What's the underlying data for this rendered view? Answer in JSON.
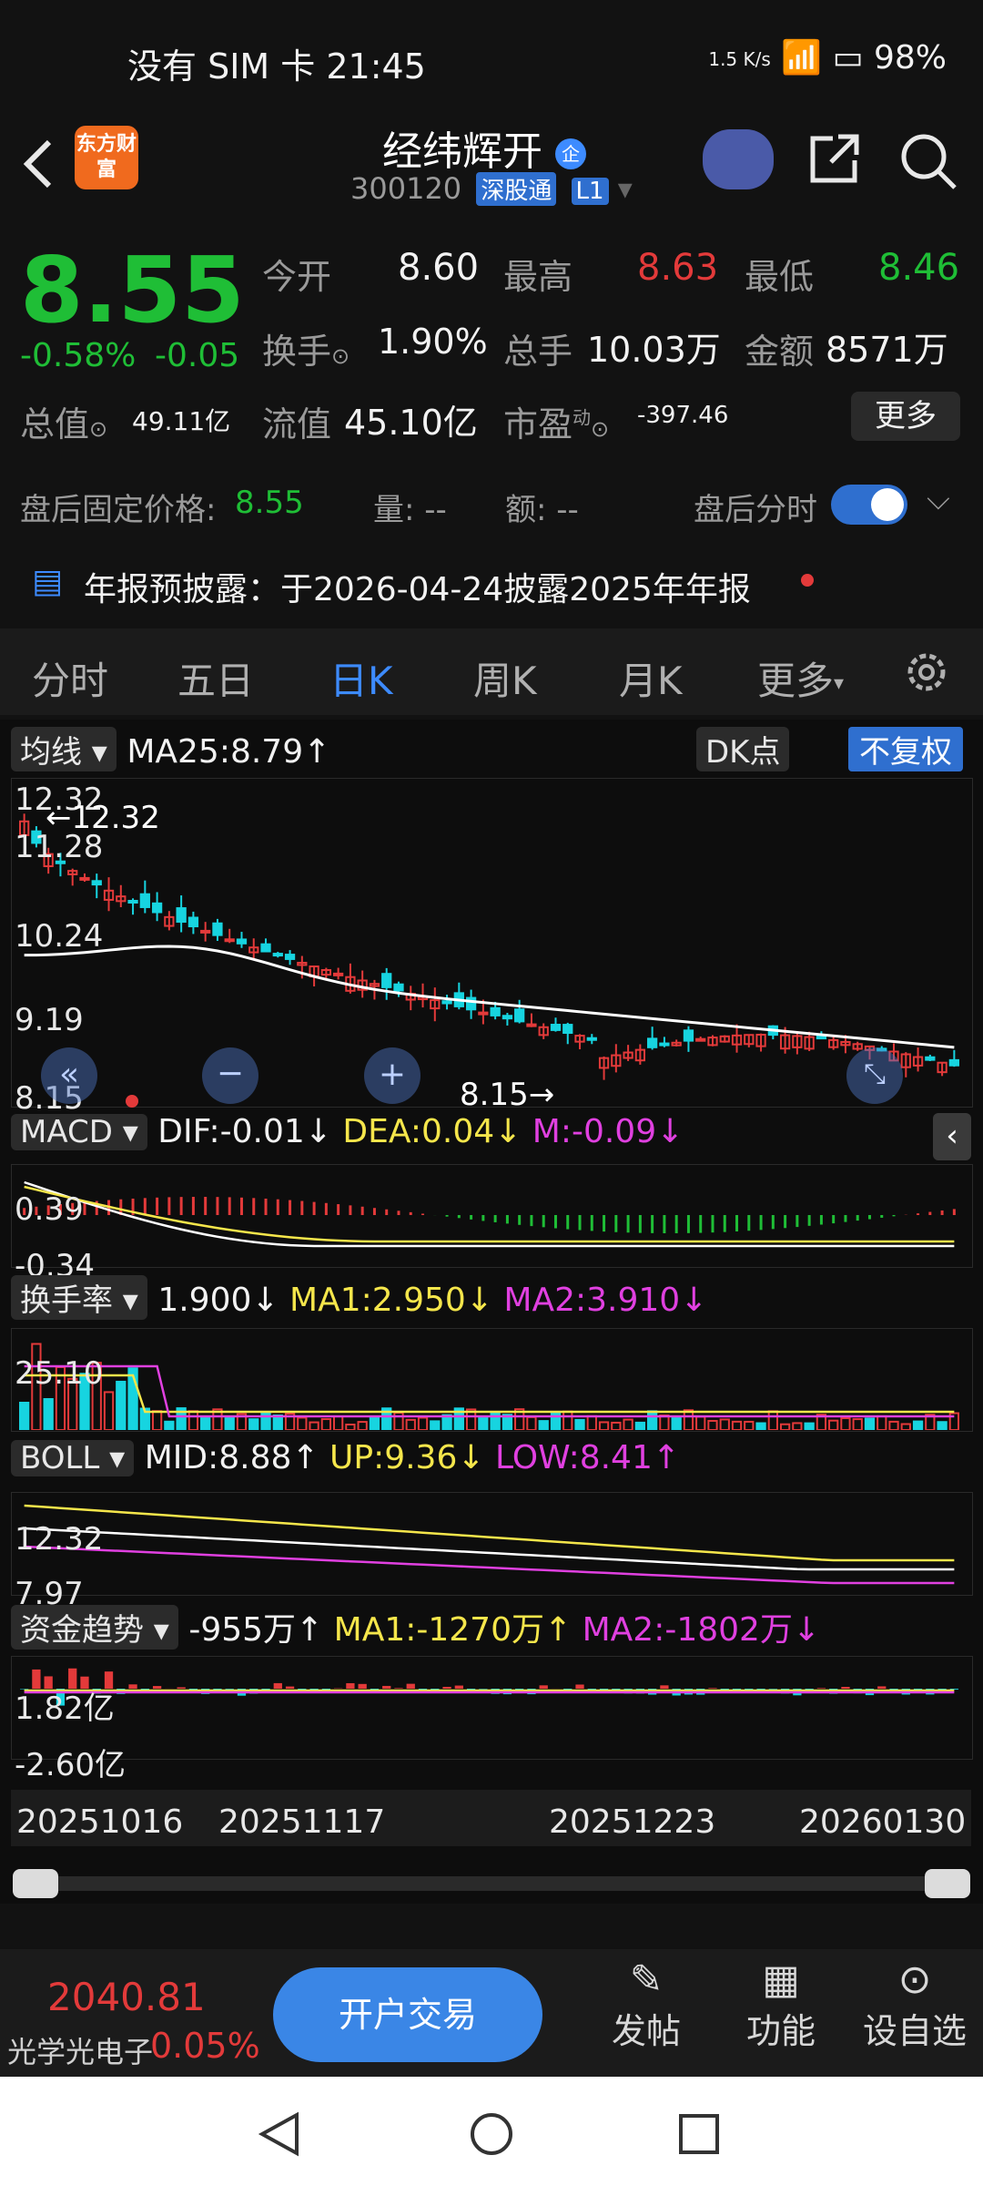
{
  "status_bar": {
    "time": "没有 SIM 卡 21:45",
    "speed": "1.5 K/s",
    "battery": "98%"
  },
  "header": {
    "name": "经纬辉开",
    "code": "300120",
    "badge1": "深股通",
    "badge2": "L1",
    "logo_text": "东方财富"
  },
  "quote": {
    "price": "8.55",
    "change_pct": "-0.58%",
    "change": "-0.05",
    "open_label": "今开",
    "open": "8.60",
    "high_label": "最高",
    "high": "8.63",
    "low_label": "最低",
    "low": "8.46",
    "turnover_label": "换手",
    "turnover": "1.90%",
    "volume_label": "总手",
    "volume": "10.03万",
    "amount_label": "金额",
    "amount": "8571万",
    "mktcap_label": "总值",
    "mktcap": "49.11亿",
    "float_label": "流值",
    "float": "45.10亿",
    "pe_label": "市盈",
    "pe_sup": "动",
    "pe": "-397.46",
    "more": "更多"
  },
  "after_hours": {
    "label": "盘后固定价格:",
    "price": "8.55",
    "vol_label": "量: --",
    "amt_label": "额: --",
    "toggle_label": "盘后分时"
  },
  "notice": {
    "text": "年报预披露：于2026-04-24披露2025年年报"
  },
  "tabs": [
    "分时",
    "五日",
    "日K",
    "周K",
    "月K",
    "更多"
  ],
  "kline": {
    "ma_chip": "均线",
    "ma_text": "MA25:8.79↑",
    "dk_chip": "DK点",
    "fq_chip": "不复权",
    "y_labels": [
      "12.32",
      "11.28",
      "10.24",
      "9.19",
      "8.15"
    ],
    "max_note": "←12.32",
    "min_note": "8.15→"
  },
  "macd": {
    "chip": "MACD",
    "dif": "DIF:-0.01↓",
    "dea": "DEA:0.04↓",
    "m": "M:-0.09↓",
    "y_labels": [
      "0.39",
      "-0.34"
    ]
  },
  "turnover_panel": {
    "chip": "换手率",
    "v": "1.900↓",
    "ma1": "MA1:2.950↓",
    "ma2": "MA2:3.910↓",
    "y_labels": [
      "25.10",
      ""
    ]
  },
  "boll": {
    "chip": "BOLL",
    "mid": "MID:8.88↑",
    "up": "UP:9.36↓",
    "low": "LOW:8.41↑",
    "y_labels": [
      "12.32",
      "7.97"
    ]
  },
  "fund": {
    "chip": "资金趋势",
    "v": "-955万↑",
    "ma1": "MA1:-1270万↑",
    "ma2": "MA2:-1802万↓",
    "y_labels": [
      "1.82亿",
      "-2.60亿"
    ]
  },
  "dates": [
    "20251016",
    "20251117",
    "20251223",
    "20260130"
  ],
  "bottom": {
    "index_value": "2040.81",
    "index_name": "光学光电子",
    "index_pct": "0.05%",
    "trade": "开户交易",
    "post": "发帖",
    "func": "功能",
    "watch": "设自选"
  },
  "colors": {
    "up": "#e33a3a",
    "down": "#1fbe36",
    "accent": "#3d8bff"
  }
}
